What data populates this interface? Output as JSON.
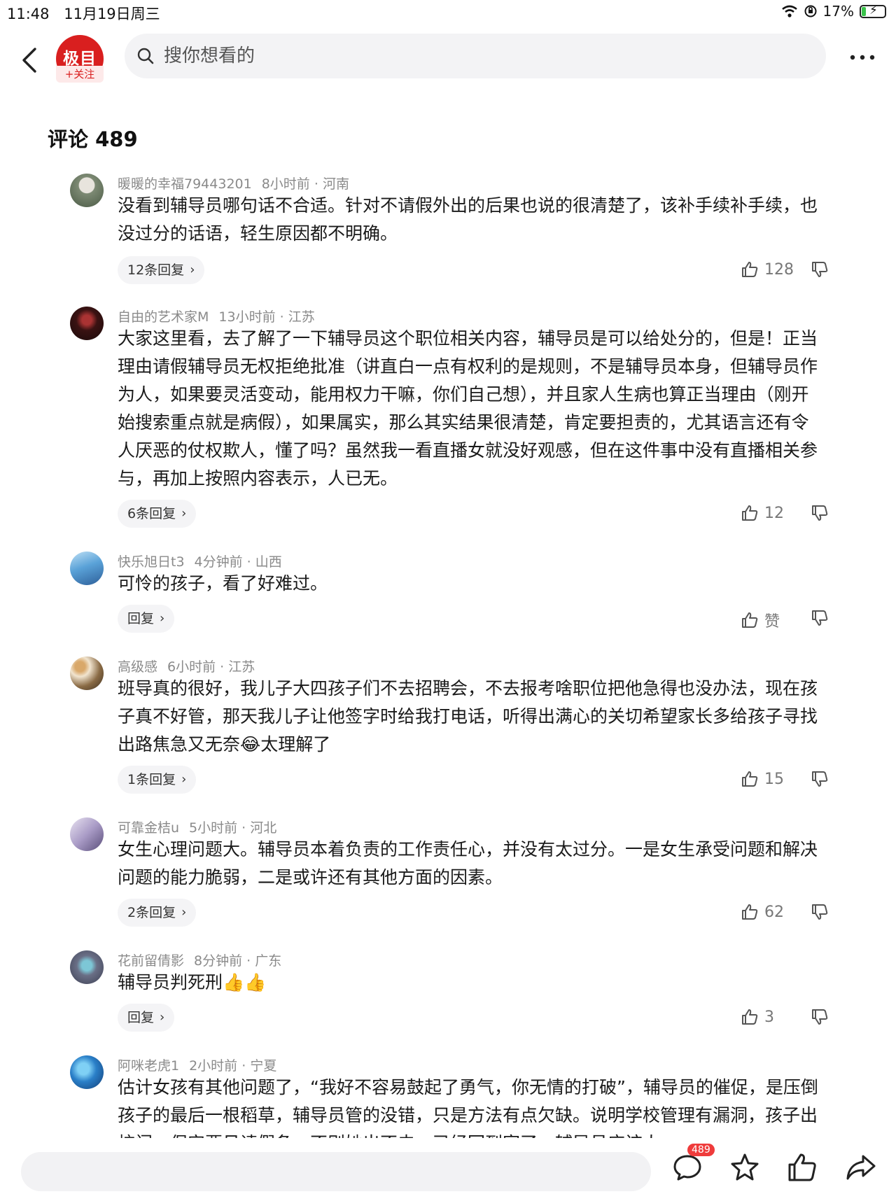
{
  "status_bar": {
    "time": "11:48",
    "date": "11月19日周三",
    "battery": "17%"
  },
  "header": {
    "logo_text": "极目",
    "follow_label": "+关注",
    "search_placeholder": "搜你想看的"
  },
  "comments_title": "评论 489",
  "comments": [
    {
      "user": "暖暖的幸福79443201",
      "time": "8小时前",
      "location": "河南",
      "text": "没看到辅导员哪句话不合适。针对不请假外出的后果也说的很清楚了，该补手续补手续，也没过分的话语，轻生原因都不明确。",
      "replies": "12条回复",
      "likes": "128"
    },
    {
      "user": "自由的艺术家M",
      "time": "13小时前",
      "location": "江苏",
      "text": "大家这里看，去了解了一下辅导员这个职位相关内容，辅导员是可以给处分的，但是！正当理由请假辅导员无权拒绝批准（讲直白一点有权利的是规则，不是辅导员本身，但辅导员作为人，如果要灵活变动，能用权力干嘛，你们自己想），并且家人生病也算正当理由（刚开始搜索重点就是病假），如果属实，那么其实结果很清楚，肯定要担责的，尤其语言还有令人厌恶的仗权欺人，懂了吗？虽然我一看直播女就没好观感，但在这件事中没有直播相关参与，再加上按照内容表示，人已无。",
      "replies": "6条回复",
      "likes": "12"
    },
    {
      "user": "快乐旭日t3",
      "time": "4分钟前",
      "location": "山西",
      "text": "可怜的孩子，看了好难过。",
      "replies": "回复",
      "likes": "赞"
    },
    {
      "user": "高级感",
      "time": "6小时前",
      "location": "江苏",
      "text": "班导真的很好，我儿子大四孩子们不去招聘会，不去报考啥职位把他急得也没办法，现在孩子真不好管，那天我儿子让他签字时给我打电话，听得出满心的关切希望家长多给孩子寻找出路焦急又无奈😂太理解了",
      "replies": "1条回复",
      "likes": "15"
    },
    {
      "user": "可靠金桔u",
      "time": "5小时前",
      "location": "河北",
      "text": "女生心理问题大。辅导员本着负责的工作责任心，并没有太过分。一是女生承受问题和解决问题的能力脆弱，二是或许还有其他方面的因素。",
      "replies": "2条回复",
      "likes": "62"
    },
    {
      "user": "花前留倩影",
      "time": "8分钟前",
      "location": "广东",
      "text": "辅导员判死刑👍👍",
      "replies": "回复",
      "likes": "3"
    },
    {
      "user": "阿咪老虎1",
      "time": "2小时前",
      "location": "宁夏",
      "text": "估计女孩有其他问题了，“我好不容易鼓起了勇气，你无情的打破”，辅导员的催促，是压倒孩子的最后一根稻草，辅导员管的没错，只是方法有点欠缺。说明学校管理有漏洞，孩子出校门，保安要见请假条，不则她出不去，已经回到家了，辅导员应该人",
      "replies": "",
      "likes": ""
    }
  ],
  "bottom_bar": {
    "comment_count_badge": "489"
  },
  "colors": {
    "accent": "#d91f1f",
    "meta_gray": "#8a8a8a",
    "badge": "#ef3b3b"
  }
}
